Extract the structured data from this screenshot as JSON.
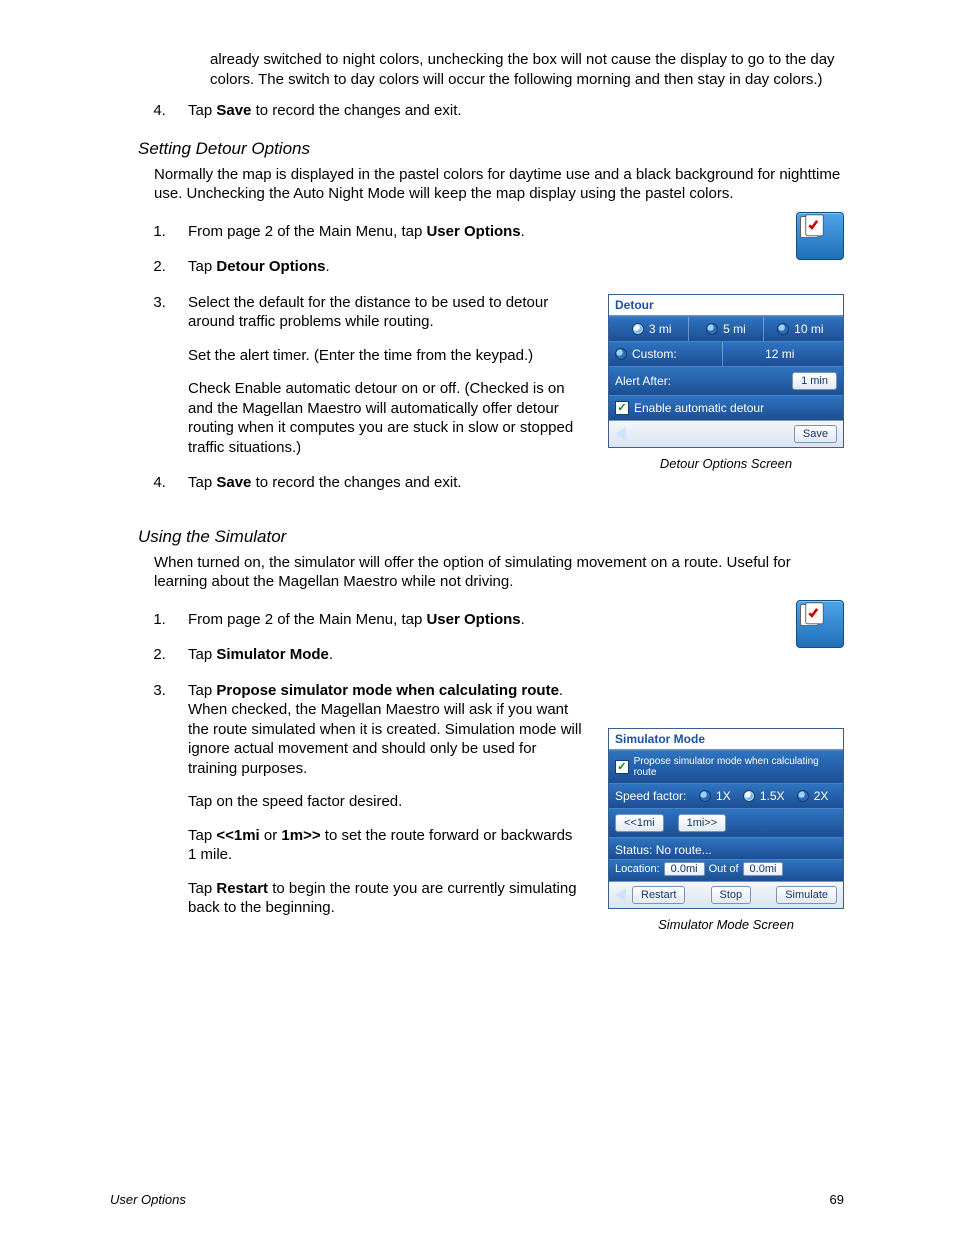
{
  "intro_continued": "already switched to night colors, unchecking the box will not cause the display to go to the day colors.  The switch to day colors will occur the following morning and then stay in day colors.)",
  "step4a_pre": "Tap ",
  "step4a_bold": "Save",
  "step4a_post": " to record the changes and exit.",
  "detour": {
    "heading": "Setting Detour Options",
    "intro": "Normally the map is displayed in the pastel colors for daytime use and a black background for nighttime use.  Unchecking the Auto Night Mode will keep the map display using the pastel colors.",
    "s1_pre": "From page 2 of the Main Menu, tap ",
    "s1_bold": "User Options",
    "s1_post": ".",
    "s2_pre": "Tap ",
    "s2_bold": "Detour Options",
    "s2_post": ".",
    "s3a": "Select the default for the distance to be used to detour around traffic problems while routing.",
    "s3b": "Set the alert timer.  (Enter the time from the keypad.)",
    "s3c": "Check Enable automatic detour on or off.  (Checked is on and the Magellan Maestro will automatically offer detour routing when it computes you are stuck in slow or stopped traffic situations.)",
    "s4_pre": "Tap ",
    "s4_bold": "Save",
    "s4_post": " to record the changes and exit.",
    "caption": "Detour Options Screen",
    "ss": {
      "title": "Detour",
      "opt1": "3 mi",
      "opt2": "5 mi",
      "opt3": "10 mi",
      "custom_label": "Custom:",
      "custom_val": "12 mi",
      "alert_label": "Alert After:",
      "alert_val": "1 min",
      "enable": "Enable automatic detour",
      "save": "Save"
    }
  },
  "sim": {
    "heading": "Using the Simulator",
    "intro": "When turned on, the simulator will offer the option of simulating movement on a route.  Useful for learning about the Magellan Maestro while not driving.",
    "s1_pre": "From page 2 of the Main Menu, tap ",
    "s1_bold": "User Options",
    "s1_post": ".",
    "s2_pre": "Tap ",
    "s2_bold": "Simulator Mode",
    "s2_post": ".",
    "s3_pre": "Tap ",
    "s3_bold": "Propose simulator mode when calculating route",
    "s3_post": ".  When checked, the Magellan Maestro will ask if you want the route simulated when it is created.  Simulation mode will ignore actual movement and should only be used for training purposes.",
    "s3b": "Tap on the speed factor desired.",
    "s3c_pre": "Tap ",
    "s3c_b1": "<<1mi",
    "s3c_mid": " or ",
    "s3c_b2": "1m>>",
    "s3c_post": " to set the route forward or backwards 1 mile.",
    "s3d_pre": "Tap ",
    "s3d_bold": "Restart",
    "s3d_post": " to begin the route you are currently simulating back to the beginning.",
    "caption": "Simulator Mode Screen",
    "ss": {
      "title": "Simulator Mode",
      "propose": "Propose simulator mode when calculating route",
      "speed_label": "Speed factor:",
      "sp1": "1X",
      "sp2": "1.5X",
      "sp3": "2X",
      "back_btn": "<<1mi",
      "fwd_btn": "1mi>>",
      "status": "Status: No route...",
      "loc_label": "Location:",
      "loc_a": "0.0mi",
      "outof": "Out of",
      "loc_b": "0.0mi",
      "restart": "Restart",
      "stop": "Stop",
      "simulate": "Simulate"
    }
  },
  "footer": {
    "left": "User Options",
    "right": "69"
  }
}
